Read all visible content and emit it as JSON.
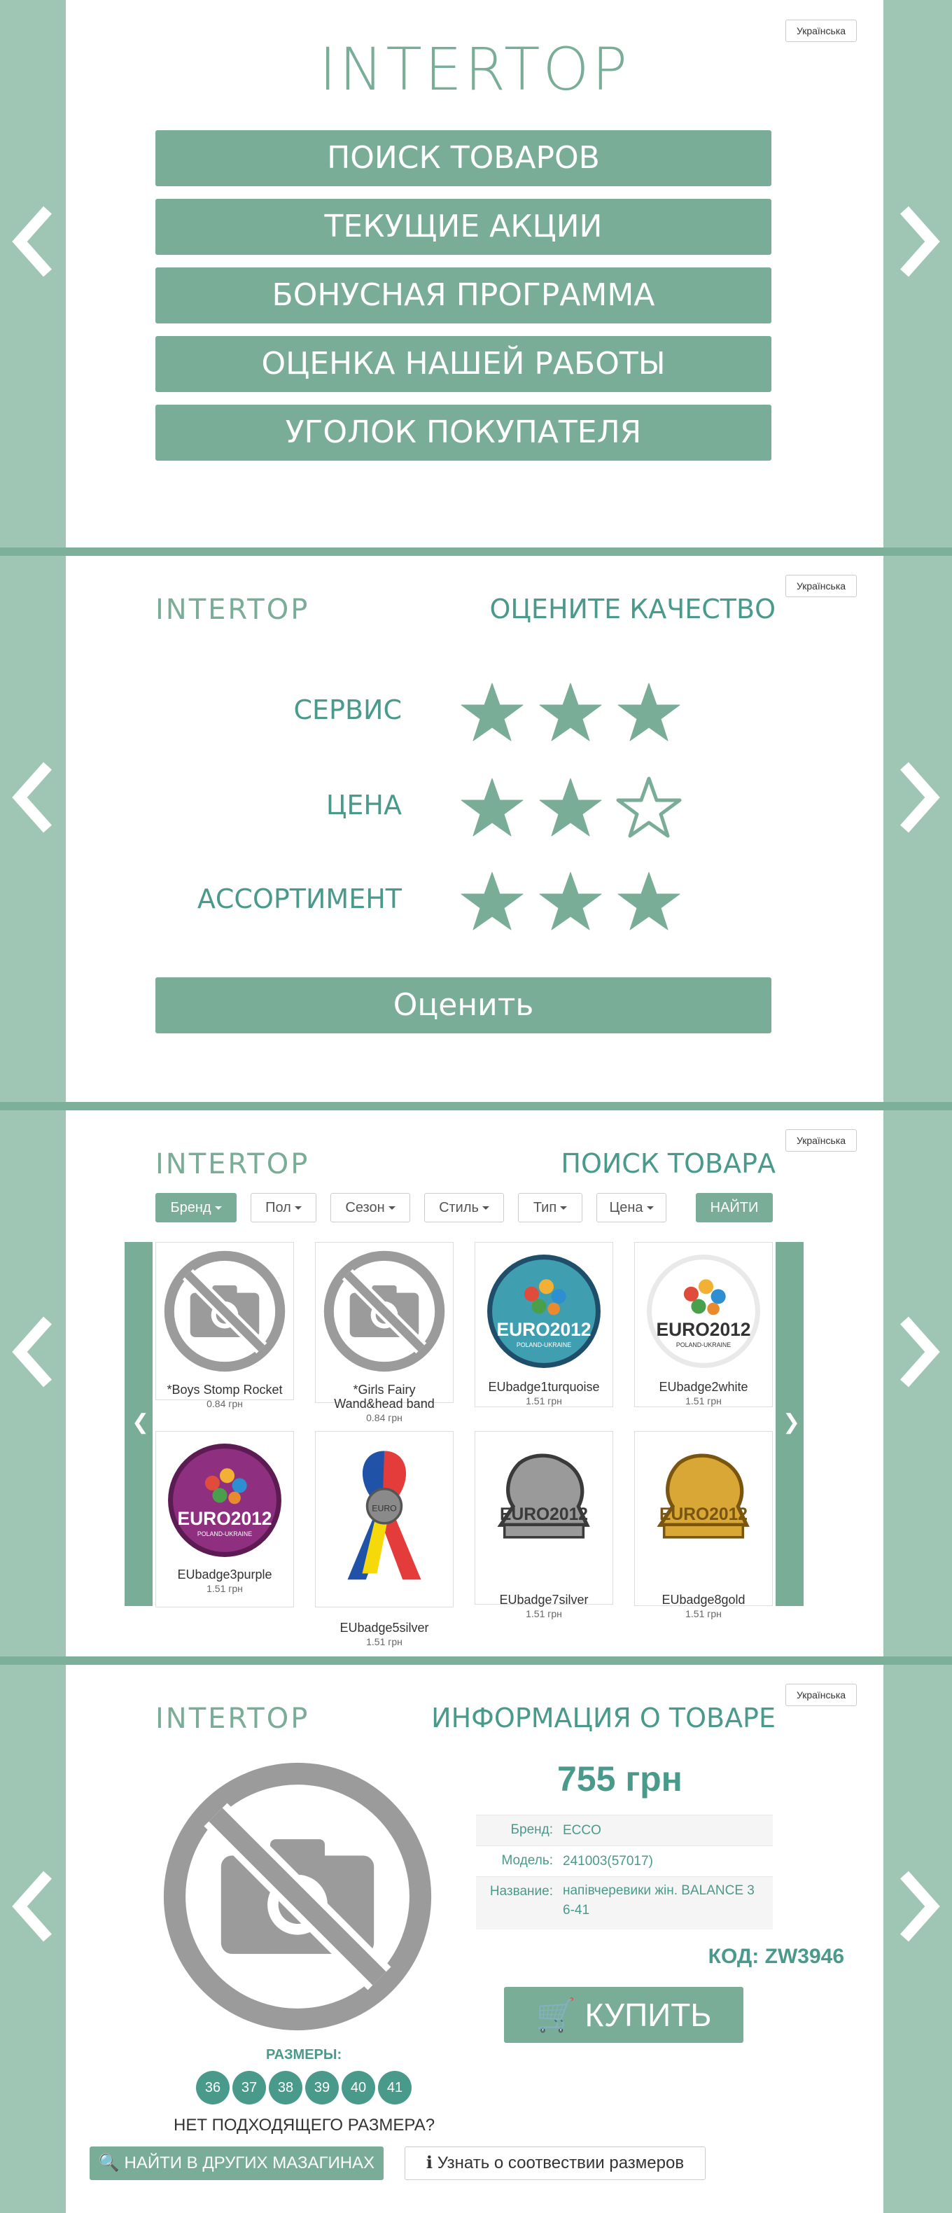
{
  "colors": {
    "accent": "#7aad98",
    "accent_dark": "#4a9a8c",
    "side": "#9fc6b4",
    "divider": "#7db09a"
  },
  "lang": "Українська",
  "logo": "INTERTOP",
  "menu": {
    "items": [
      "ПОИСК ТОВАРОВ",
      "ТЕКУЩИЕ АКЦИИ",
      "БОНУСНАЯ ПРОГРАММА",
      "ОЦЕНКА НАШЕЙ РАБОТЫ",
      "УГОЛОК ПОКУПАТЕЛЯ"
    ]
  },
  "rating": {
    "title": "ОЦЕНИТЕ КАЧЕСТВО",
    "rows": [
      {
        "label": "СЕРВИС",
        "stars": 3
      },
      {
        "label": "ЦЕНА",
        "stars": 2
      },
      {
        "label": "АССОРТИМЕНТ",
        "stars": 3
      }
    ],
    "max_stars": 3,
    "submit": "Оценить"
  },
  "search": {
    "title": "ПОИСК ТОВАРА",
    "filters": [
      "Бренд",
      "Пол",
      "Сезон",
      "Стиль",
      "Тип",
      "Цена"
    ],
    "find": "НАЙТИ",
    "products": [
      {
        "name": "*Boys Stomp Rocket",
        "price": "0.84 грн",
        "image": "no-photo-icon"
      },
      {
        "name": "*Girls Fairy Wand&head band",
        "price": "0.84 грн",
        "image": "no-photo-icon"
      },
      {
        "name": "EUbadge1turquoise",
        "price": "1.51 грн",
        "image": "euro2012-badge-turquoise"
      },
      {
        "name": "EUbadge2white",
        "price": "1.51 грн",
        "image": "euro2012-badge-white"
      },
      {
        "name": "EUbadge3purple",
        "price": "1.51 грн",
        "image": "euro2012-badge-purple"
      },
      {
        "name": "EUbadge5silver",
        "price": "1.51 грн",
        "image": "euro2012-ribbon-badge"
      },
      {
        "name": "EUbadge7silver",
        "price": "1.51 грн",
        "image": "euro2012-pin-silver"
      },
      {
        "name": "EUbadge8gold",
        "price": "1.51 грн",
        "image": "euro2012-pin-gold"
      }
    ]
  },
  "product": {
    "title": "ИНФОРМАЦИЯ О ТОВАРЕ",
    "price": "755 грн",
    "brand_label": "Бренд:",
    "brand": "ECCO",
    "model_label": "Модель:",
    "model": "241003(57017)",
    "name_label": "Название:",
    "name": "напівчеревики жін. BALANCE 3 6-41",
    "code": "КОД: ZW3946",
    "buy": "КУПИТЬ",
    "sizes_title": "РАЗМЕРЫ:",
    "sizes": [
      "36",
      "37",
      "38",
      "39",
      "40",
      "41"
    ],
    "no_size": "НЕТ ПОДХОДЯЩЕГО РАЗМЕРА?",
    "other_stores": "НАЙТИ В ДРУГИХ МАЗАГИНАХ",
    "size_info": "Узнать о соотвествии размеров"
  }
}
